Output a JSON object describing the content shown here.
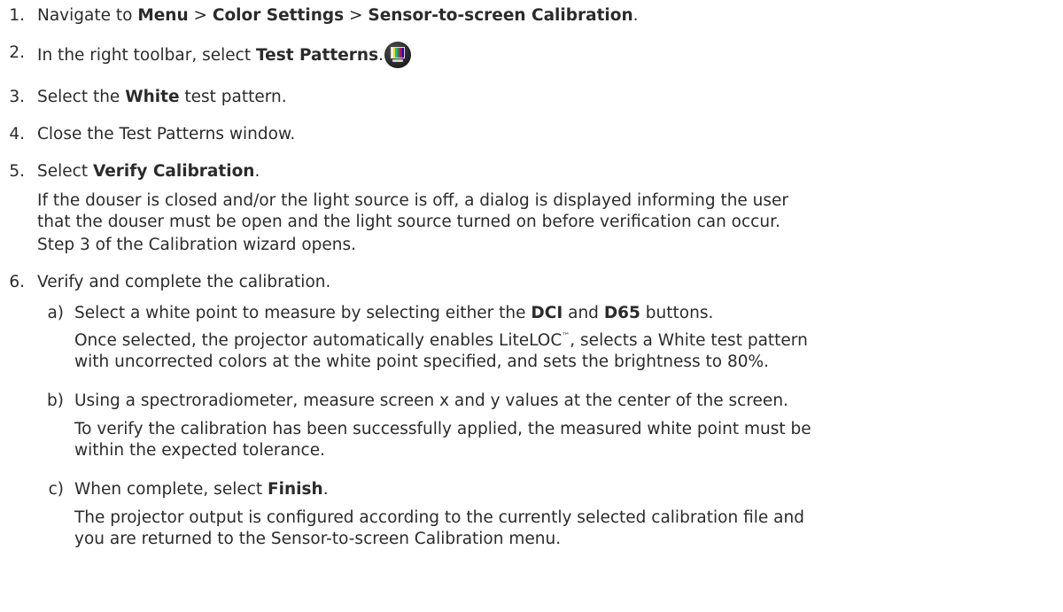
{
  "steps": [
    {
      "number": "1.",
      "pre": "Navigate to ",
      "b1": "Menu",
      "sep1": " > ",
      "b2": "Color Settings",
      "sep2": " > ",
      "b3": "Sensor-to-screen Calibration",
      "post": "."
    },
    {
      "number": "2.",
      "pre": "In the right toolbar, select ",
      "bold": "Test Patterns",
      "post": ".",
      "icon": "test-patterns-icon"
    },
    {
      "number": "3.",
      "pre": "Select the ",
      "bold": "White",
      "post": " test pattern."
    },
    {
      "number": "4.",
      "text": "Close the Test Patterns window."
    },
    {
      "number": "5.",
      "pre": "Select ",
      "bold": "Verify Calibration",
      "post": ".",
      "para1_line1": "If the douser is closed and/or the light source is off, a dialog is displayed informing the user",
      "para1_line2": "that the douser must be open and the light source turned on before verification can occur.",
      "para2": "Step 3 of the Calibration wizard opens."
    },
    {
      "number": "6.",
      "text": "Verify and complete the calibration.",
      "substeps": [
        {
          "letter": "a)",
          "pre": "Select a white point to measure by selecting either the ",
          "b1": "DCI",
          "mid": " and ",
          "b2": "D65",
          "post": " buttons.",
          "para_line1_pre": "Once selected, the projector automatically enables LiteLOC",
          "tm": "™",
          "para_line1_post": ", selects a White test pattern",
          "para_line2": "with uncorrected colors at the white point specified, and sets the brightness to 80%."
        },
        {
          "letter": "b)",
          "text": "Using a spectroradiometer, measure screen x and y values at the center of the screen.",
          "para_line1": "To verify the calibration has been successfully applied, the measured white point must be",
          "para_line2": "within the expected tolerance."
        },
        {
          "letter": "c)",
          "pre": "When complete, select ",
          "bold": "Finish",
          "post": ".",
          "para_line1": "The projector output is configured according to the currently selected calibration file and",
          "para_line2": "you are returned to the Sensor-to-screen Calibration menu."
        }
      ]
    }
  ],
  "colors": {
    "text": "#2b2b2b",
    "background": "#ffffff"
  },
  "icon_bars": [
    "#f2f2f2",
    "#f0e000",
    "#00c0c0",
    "#00c000",
    "#c000c0",
    "#e00000",
    "#0000e0"
  ]
}
